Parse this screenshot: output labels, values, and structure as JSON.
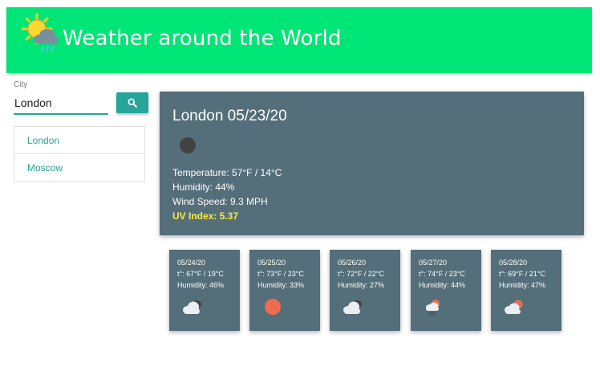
{
  "header": {
    "title": "Weather around the World",
    "logo_icon": "sun-cloud-rain-icon",
    "background_color": "#00e676"
  },
  "search": {
    "label": "City",
    "value": "London",
    "button_icon": "search-icon",
    "accent_color": "#26a69a"
  },
  "history": [
    {
      "label": "London"
    },
    {
      "label": "Moscow"
    }
  ],
  "current": {
    "heading": "London 05/23/20",
    "icon": "night-clear-icon",
    "temperature": "Temperature: 57°F / 14°C",
    "humidity": "Humidity: 44%",
    "wind": "Wind Speed: 9.3 MPH",
    "uv": "UV Index: 5.37",
    "uv_color": "#ffeb3b",
    "card_color": "#546e7a"
  },
  "forecast": [
    {
      "date": "05/24/20",
      "temp": "t°: 67°F / 19°C",
      "humidity": "Humidity: 46%",
      "icon": "night-cloudy-icon"
    },
    {
      "date": "05/25/20",
      "temp": "t°: 73°F / 23°C",
      "humidity": "Humidity: 33%",
      "icon": "sun-icon"
    },
    {
      "date": "05/26/20",
      "temp": "t°: 72°F / 22°C",
      "humidity": "Humidity: 27%",
      "icon": "night-cloudy-icon"
    },
    {
      "date": "05/27/20",
      "temp": "t°: 74°F / 23°C",
      "humidity": "Humidity: 44%",
      "icon": "sun-cloud-rain-icon"
    },
    {
      "date": "05/28/20",
      "temp": "t°: 69°F / 21°C",
      "humidity": "Humidity: 47%",
      "icon": "sun-cloud-icon"
    }
  ]
}
